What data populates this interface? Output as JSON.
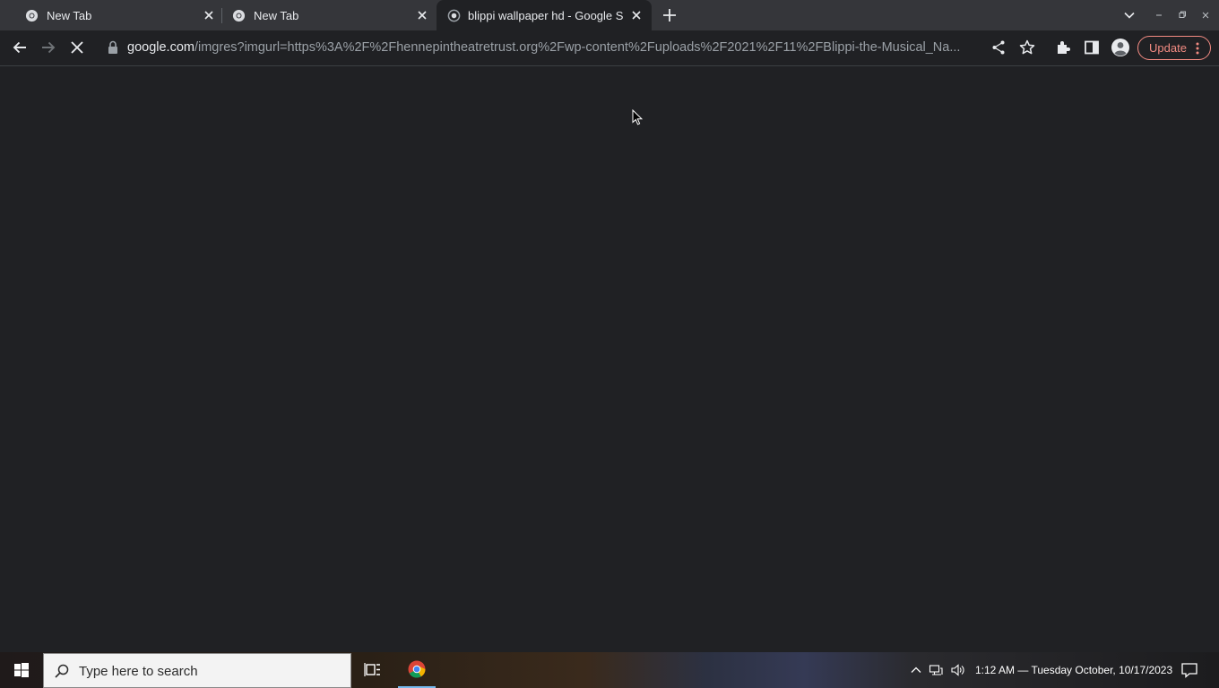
{
  "browser": {
    "tabs": [
      {
        "title": "New Tab",
        "active": false
      },
      {
        "title": "New Tab",
        "active": false
      },
      {
        "title": "blippi wallpaper hd - Google S",
        "active": true
      }
    ],
    "address_bar": {
      "host": "google.com",
      "path": "/imgres?imgurl=https%3A%2F%2Fhennepintheatretrust.org%2Fwp-content%2Fuploads%2F2021%2F11%2FBlippi-the-Musical_Na..."
    },
    "update_label": "Update",
    "page_loading": true
  },
  "taskbar": {
    "search_placeholder": "Type here to search",
    "clock": "1:12 AM — Tuesday October, 10/17/2023"
  },
  "colors": {
    "tabstrip_bg": "#35363a",
    "page_bg": "#202124",
    "update_accent": "#f28b82",
    "active_task_underline": "#76b9ed"
  },
  "icons": [
    "chrome-favicon-icon",
    "tab-close-icon",
    "new-tab-icon",
    "tab-search-chevron-icon",
    "minimize-icon",
    "maximize-icon",
    "window-close-icon",
    "back-arrow-icon",
    "forward-arrow-icon",
    "stop-loading-icon",
    "lock-icon",
    "share-icon",
    "star-icon",
    "extensions-icon",
    "side-panel-icon",
    "profile-icon",
    "more-menu-icon",
    "windows-start-icon",
    "search-icon",
    "task-view-icon",
    "chrome-taskbar-icon",
    "tray-chevron-icon",
    "network-icon",
    "volume-icon",
    "notifications-icon",
    "mouse-cursor-icon"
  ]
}
